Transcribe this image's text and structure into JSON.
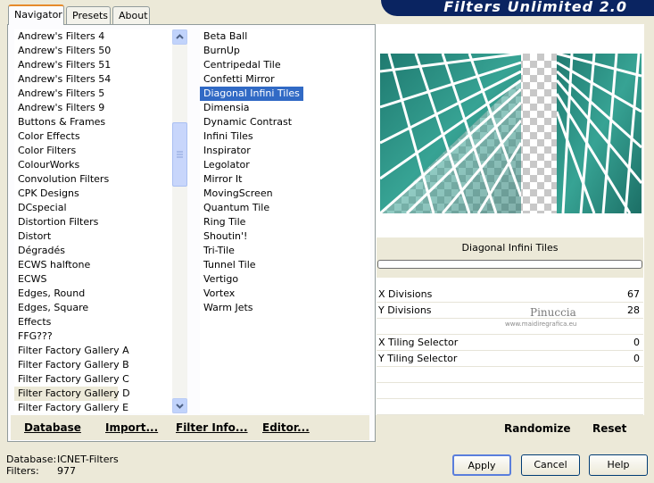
{
  "tabs": [
    {
      "label": "Navigator"
    },
    {
      "label": "Presets"
    },
    {
      "label": "About"
    }
  ],
  "banner_title": "Filters Unlimited 2.0",
  "categories": [
    "Andrew's Filters 4",
    "Andrew's Filters 50",
    "Andrew's Filters 51",
    "Andrew's Filters 54",
    "Andrew's Filters 5",
    "Andrew's Filters 9",
    "Buttons & Frames",
    "Color Effects",
    "Color Filters",
    "ColourWorks",
    "Convolution Filters",
    "CPK Designs",
    "DCspecial",
    "Distortion Filters",
    "Distort",
    "Dégradés",
    "ECWS halftone",
    "ECWS",
    "Edges, Round",
    "Edges, Square",
    "Effects",
    "FFG???",
    "Filter Factory Gallery A",
    "Filter Factory Gallery B",
    "Filter Factory Gallery C",
    "Filter Factory Gallery D",
    "Filter Factory Gallery E"
  ],
  "selected_category": "Filter Factory Gallery D",
  "filters": [
    "Beta Ball",
    "BurnUp",
    "Centripedal Tile",
    "Confetti Mirror",
    "Diagonal Infini Tiles",
    "Dimensia",
    "Dynamic Contrast",
    "Infini Tiles",
    "Inspirator",
    "Legolator",
    "Mirror It",
    "MovingScreen",
    "Quantum Tile",
    "Ring Tile",
    "Shoutin'!",
    "Tri-Tile",
    "Tunnel Tile",
    "Vertigo",
    "Vortex",
    "Warm Jets"
  ],
  "selected_filter": "Diagonal Infini Tiles",
  "bottom_buttons": {
    "database": "Database",
    "import": "Import...",
    "filter_info": "Filter Info...",
    "editor": "Editor..."
  },
  "filter_title": "Diagonal Infini Tiles",
  "params": [
    {
      "label": "X Divisions",
      "value": "67"
    },
    {
      "label": "Y Divisions",
      "value": "28"
    },
    {
      "label": "X Tiling Selector",
      "value": "0"
    },
    {
      "label": "Y Tiling Selector",
      "value": "0"
    }
  ],
  "watermark": {
    "line1": "Pinuccia",
    "line2": "www.maidiregrafica.eu"
  },
  "right_buttons": {
    "randomize": "Randomize",
    "reset": "Reset"
  },
  "status": {
    "database_label": "Database:",
    "database_value": "ICNET-Filters",
    "filters_label": "Filters:",
    "filters_value": "977"
  },
  "dialog_buttons": {
    "apply": "Apply",
    "cancel": "Cancel",
    "help": "Help"
  },
  "colors": {
    "teal": "#2a8c80",
    "selection": "#316ac5",
    "banner": "#0a2461"
  }
}
